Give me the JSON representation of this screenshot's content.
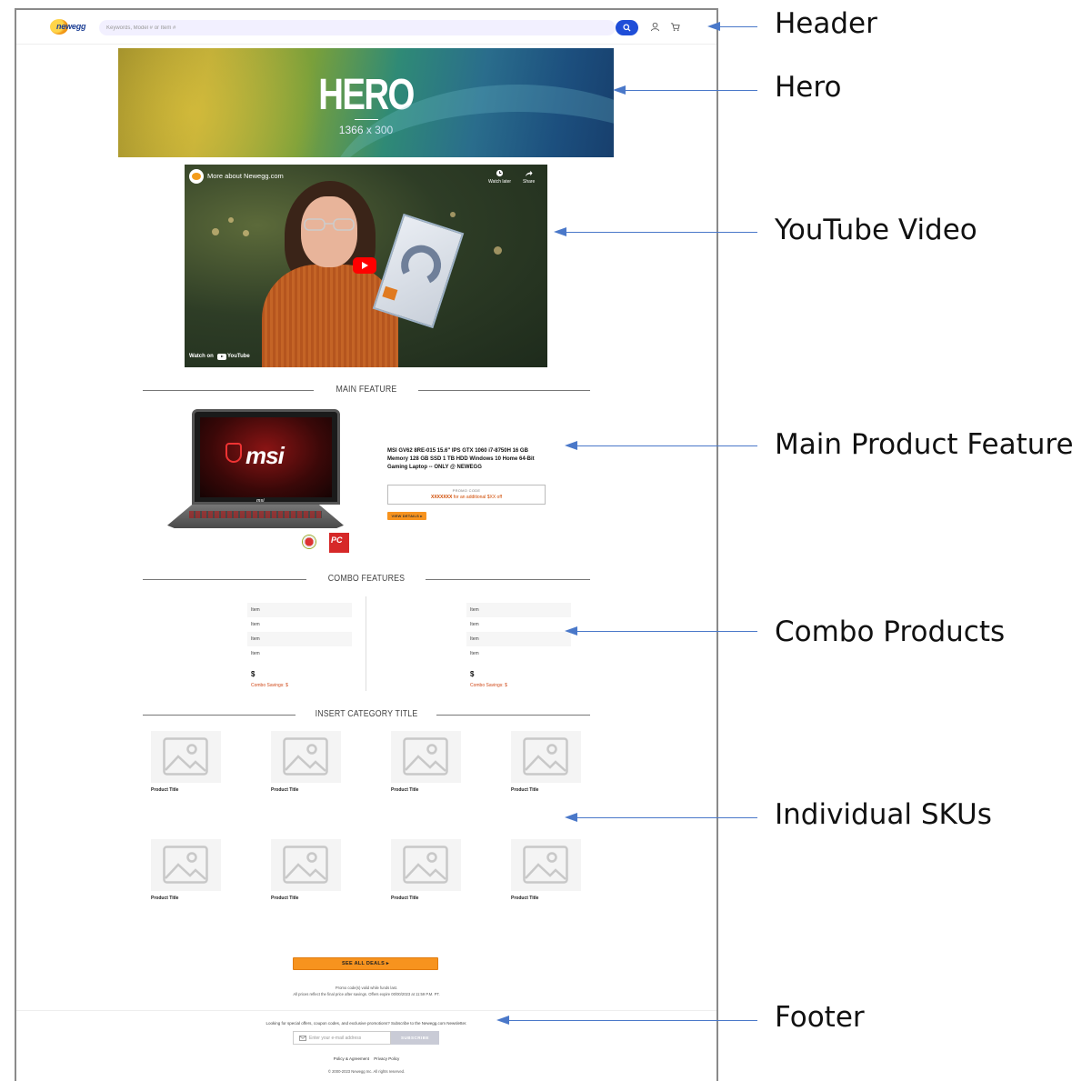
{
  "header": {
    "logo_text": "newegg",
    "search_placeholder": "Keywords, Model # or Item #",
    "icons": [
      "search-icon",
      "user-icon",
      "cart-icon"
    ]
  },
  "hero": {
    "title": "HERO",
    "size": "1366 x 300"
  },
  "video": {
    "channel_title": "More about Newegg.com",
    "watch_later": "Watch later",
    "share": "Share",
    "watch_on": "Watch on",
    "platform": "YouTube"
  },
  "main_feature": {
    "heading": "MAIN FEATURE",
    "laptop_brand": "msi",
    "product_title": "MSI GV62 8RE-015 15.6\" IPS GTX 1060 i7-8750H 16 GB Memory 128 GB SSD 1 TB HDD Windows 10 Home 64-Bit Gaming Laptop -- ONLY @ NEWEGG",
    "promo_label": "PROMO CODE",
    "promo_code": "XXXXXXX",
    "promo_text": " for an additional $XX off",
    "view_details": "VIEW DETAILS ▸",
    "badge_text": "PC"
  },
  "combo": {
    "heading": "COMBO FEATURES",
    "columns": [
      {
        "items": [
          "Item",
          "Item",
          "Item",
          "Item"
        ],
        "price": "$",
        "savings": "Combo Savings: $"
      },
      {
        "items": [
          "Item",
          "Item",
          "Item",
          "Item"
        ],
        "price": "$",
        "savings": "Combo Savings: $"
      }
    ]
  },
  "skus": {
    "heading": "INSERT CATEGORY TITLE",
    "products": [
      "Product Title",
      "Product Title",
      "Product Title",
      "Product Title",
      "Product Title",
      "Product Title",
      "Product Title",
      "Product Title"
    ]
  },
  "see_all": "SEE ALL DEALS ▸",
  "promo_notes": [
    "Promo code(s) valid while funds last.",
    "All prices reflect the final price after savings. Offers expire 00/00/2023 at 11:59 P.M. PT."
  ],
  "footer": {
    "newsletter_text": "Looking for special offers, coupon codes, and exclusive promotions? Subscribe to the Newegg.com Newsletter.",
    "email_placeholder": "Enter your e-mail address",
    "subscribe": "SUBSCRIBE",
    "links": [
      "Policy & Agreement",
      "Privacy Policy"
    ],
    "copyright": "© 2000-2023 Newegg Inc. All rights reserved."
  },
  "annotations": {
    "header": "Header",
    "hero": "Hero",
    "youtube": "YouTube Video",
    "main_feature": "Main Product Feature",
    "combo": "Combo Products",
    "skus": "Individual SKUs",
    "footer": "Footer"
  },
  "colors": {
    "accent_orange": "#f7931e",
    "search_blue": "#1f4ed8",
    "annotation_arrow": "#4a78c9",
    "promo_red": "#d04a00"
  }
}
